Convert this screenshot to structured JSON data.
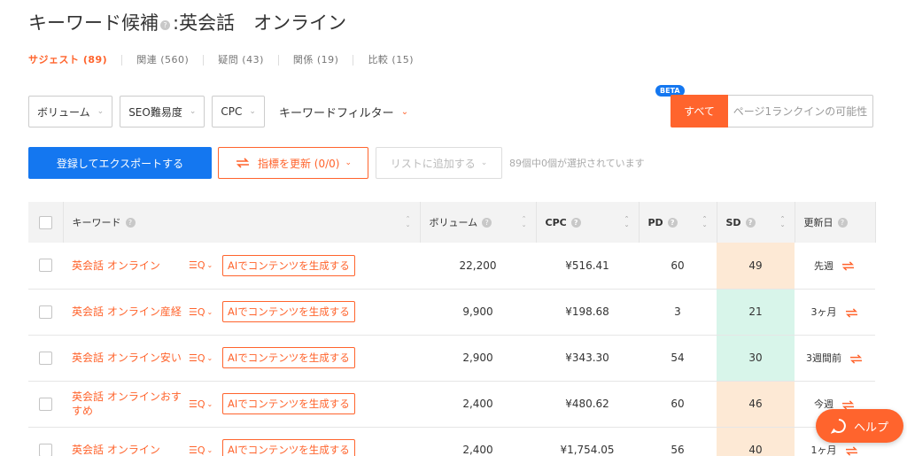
{
  "header": {
    "title_prefix": "キーワード候補",
    "help": "?",
    "title_suffix": ":英会話　オンライン"
  },
  "tabs": [
    {
      "label": "サジェスト (89)",
      "active": true
    },
    {
      "label": "関連 (560)",
      "active": false
    },
    {
      "label": "疑問 (43)",
      "active": false
    },
    {
      "label": "関係 (19)",
      "active": false
    },
    {
      "label": "比較 (15)",
      "active": false
    }
  ],
  "filters": {
    "volume": "ボリューム",
    "seo_difficulty": "SEO難易度",
    "cpc": "CPC",
    "keyword_filter": "キーワードフィルター"
  },
  "segment": {
    "beta_badge": "BETA",
    "all": "すべて",
    "page1_rank": "ページ1ランクインの可能性"
  },
  "actions": {
    "export": "登録してエクスポートする",
    "refresh": "指標を更新 (0/0)",
    "add_to_list": "リストに追加する",
    "selection_status": "89個中0個が選択されています"
  },
  "table": {
    "headers": {
      "keyword": "キーワード",
      "volume": "ボリューム",
      "cpc": "CPC",
      "pd": "PD",
      "sd": "SD",
      "updated": "更新日"
    },
    "ai_button": "AIでコンテンツを生成する",
    "rows": [
      {
        "keyword": "英会話 オンライン",
        "volume": "22,200",
        "cpc": "¥516.41",
        "pd": "60",
        "sd": "49",
        "sd_color": "#fde9d5",
        "updated": "先週"
      },
      {
        "keyword": "英会話 オンライン産経",
        "volume": "9,900",
        "cpc": "¥198.68",
        "pd": "3",
        "sd": "21",
        "sd_color": "#d8f5ea",
        "updated": "3ヶ月"
      },
      {
        "keyword": "英会話 オンライン安い",
        "volume": "2,900",
        "cpc": "¥343.30",
        "pd": "54",
        "sd": "30",
        "sd_color": "#d8f5ea",
        "updated": "3週間前"
      },
      {
        "keyword": "英会話 オンラインおすすめ",
        "volume": "2,400",
        "cpc": "¥480.62",
        "pd": "60",
        "sd": "46",
        "sd_color": "#fde9d5",
        "updated": "今週"
      },
      {
        "keyword": "英会話 オンライン",
        "volume": "2,400",
        "cpc": "¥1,754.05",
        "pd": "56",
        "sd": "40",
        "sd_color": "#fde9d5",
        "updated": "1ヶ月"
      }
    ]
  },
  "help_fab": {
    "label": "ヘルプ"
  },
  "colors": {
    "accent": "#ff642d",
    "primary_blue": "#1477f0"
  }
}
